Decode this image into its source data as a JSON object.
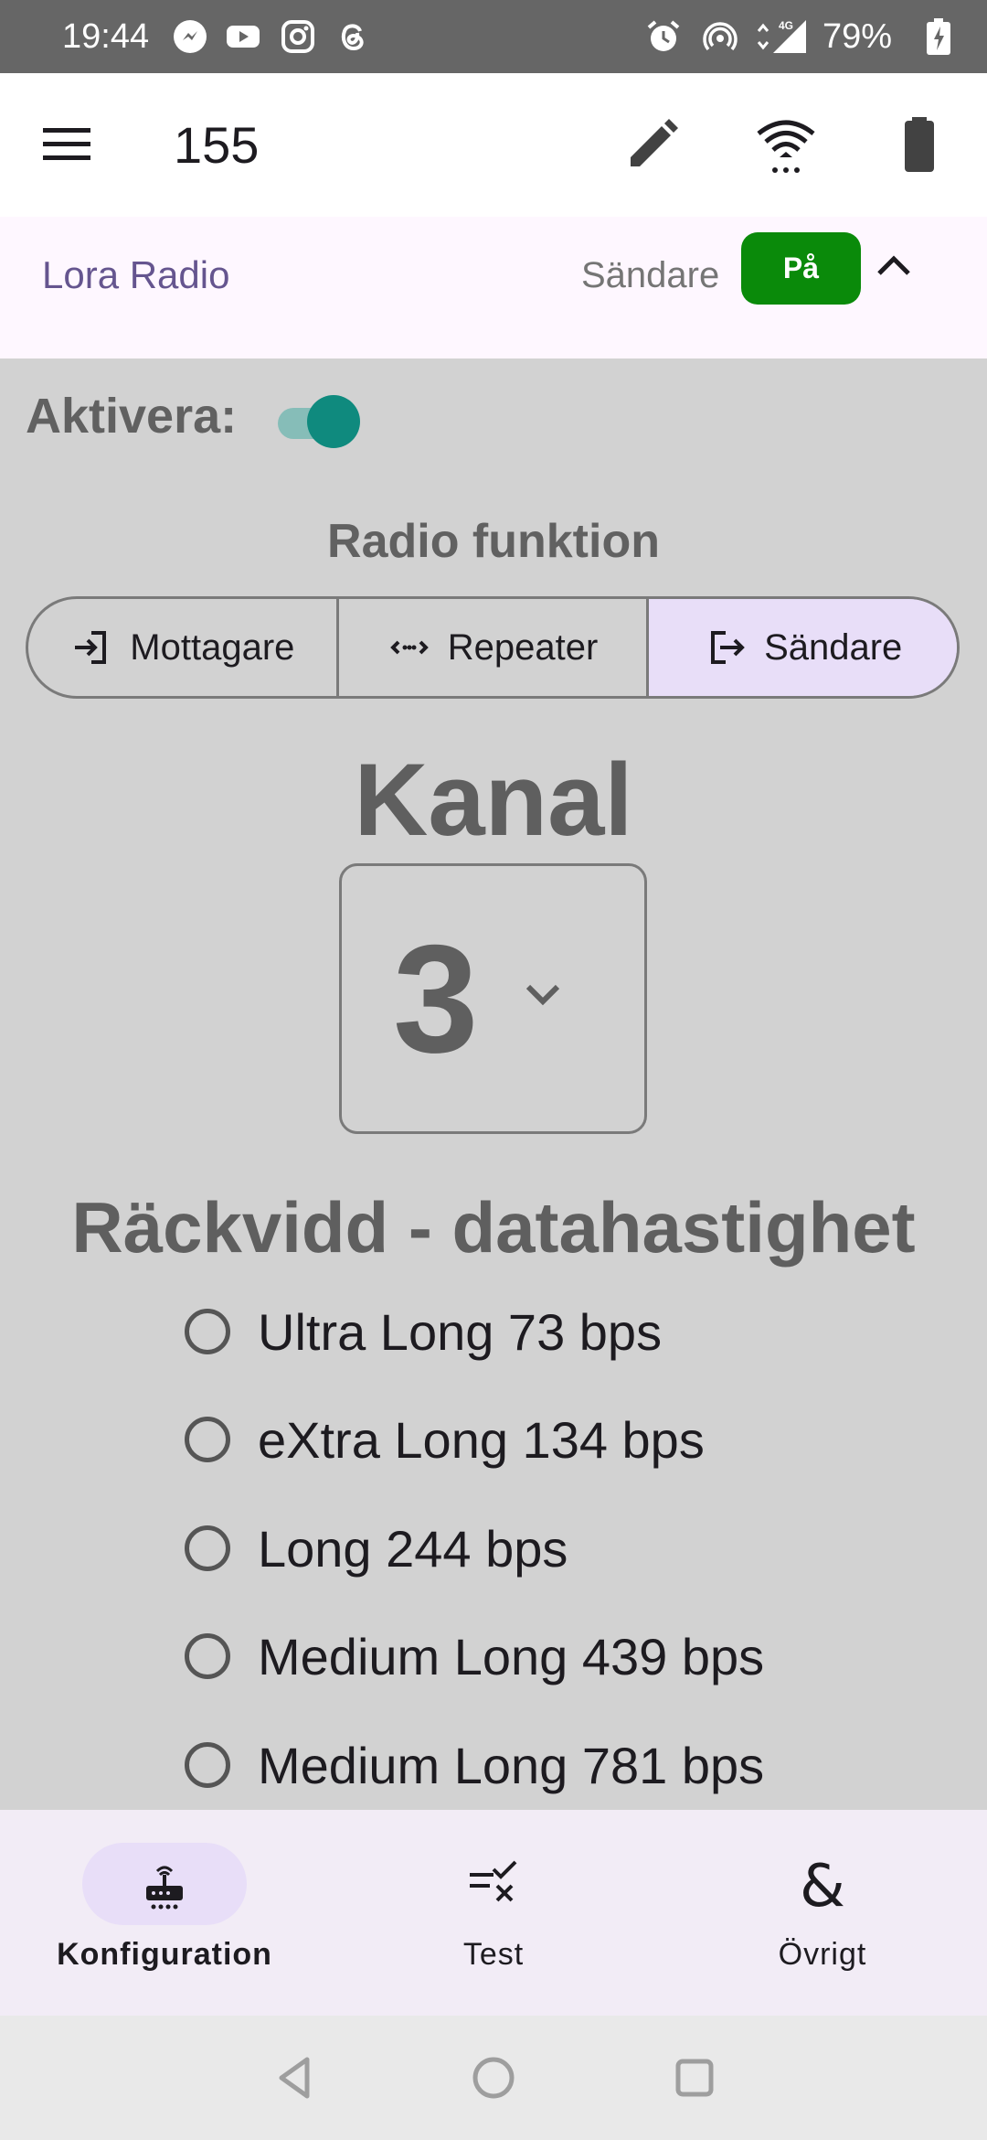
{
  "status_bar": {
    "time": "19:44",
    "battery_percent": "79%",
    "left_icons": [
      "messenger-icon",
      "youtube-icon",
      "instagram-icon",
      "threads-icon"
    ],
    "right_icons": [
      "alarm-icon",
      "hotspot-icon",
      "signal-4g-icon",
      "battery-charging-icon"
    ]
  },
  "app_bar": {
    "title": "155",
    "icons": [
      "menu-icon",
      "edit-icon",
      "wifi-icon",
      "battery-icon"
    ]
  },
  "section": {
    "title": "Lora Radio",
    "mode": "Sändare",
    "state_button": "På",
    "state_color": "#0a8a0a"
  },
  "enable": {
    "label": "Aktivera:",
    "value": true,
    "accent": "#0f8a7e"
  },
  "radio_function": {
    "title": "Radio funktion",
    "options": [
      {
        "label": "Mottagare",
        "icon": "login-icon",
        "selected": false
      },
      {
        "label": "Repeater",
        "icon": "code-dots-icon",
        "selected": false
      },
      {
        "label": "Sändare",
        "icon": "logout-icon",
        "selected": true
      }
    ]
  },
  "channel": {
    "title": "Kanal",
    "value": "3"
  },
  "range": {
    "title": "Räckvidd - datahastighet",
    "options": [
      {
        "label": "Ultra Long 73 bps",
        "selected": false
      },
      {
        "label": "eXtra Long 134 bps",
        "selected": false
      },
      {
        "label": "Long 244 bps",
        "selected": false
      },
      {
        "label": "Medium Long 439 bps",
        "selected": false
      },
      {
        "label": "Medium Long 781 bps",
        "selected": false
      }
    ]
  },
  "bottom_nav": {
    "items": [
      {
        "label": "Konfiguration",
        "icon": "router-icon",
        "active": true
      },
      {
        "label": "Test",
        "icon": "checklist-icon",
        "active": false
      },
      {
        "label": "Övrigt",
        "icon": "ampersand-icon",
        "active": false
      }
    ]
  },
  "colors": {
    "accent_purple": "#65558f",
    "selection_bg": "#e8def8",
    "status_bar": "#666666"
  }
}
